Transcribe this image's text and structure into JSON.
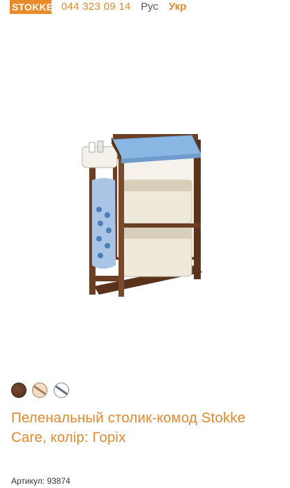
{
  "header": {
    "logo_text": "STOKKE",
    "phone": "044 323 09 14",
    "languages": [
      {
        "label": "Рус",
        "active": false
      },
      {
        "label": "Укр",
        "active": true
      }
    ]
  },
  "product": {
    "image_alt": "Пеленальный столик-комод Stokke Care",
    "color_options": [
      {
        "name": "walnut",
        "color": "#5a3624"
      },
      {
        "name": "natural",
        "color": "#f2dcc4"
      },
      {
        "name": "white",
        "color": "#ffffff"
      }
    ],
    "title": "Пеленальный столик-комод Stokke Care, колір: Горіх",
    "sku_label": "Артикул:",
    "sku_value": "93874"
  },
  "colors": {
    "accent": "#e08a2e",
    "wood": "#6b3f24",
    "pad": "#8ab6e3",
    "fabric": "#efe9dc"
  }
}
